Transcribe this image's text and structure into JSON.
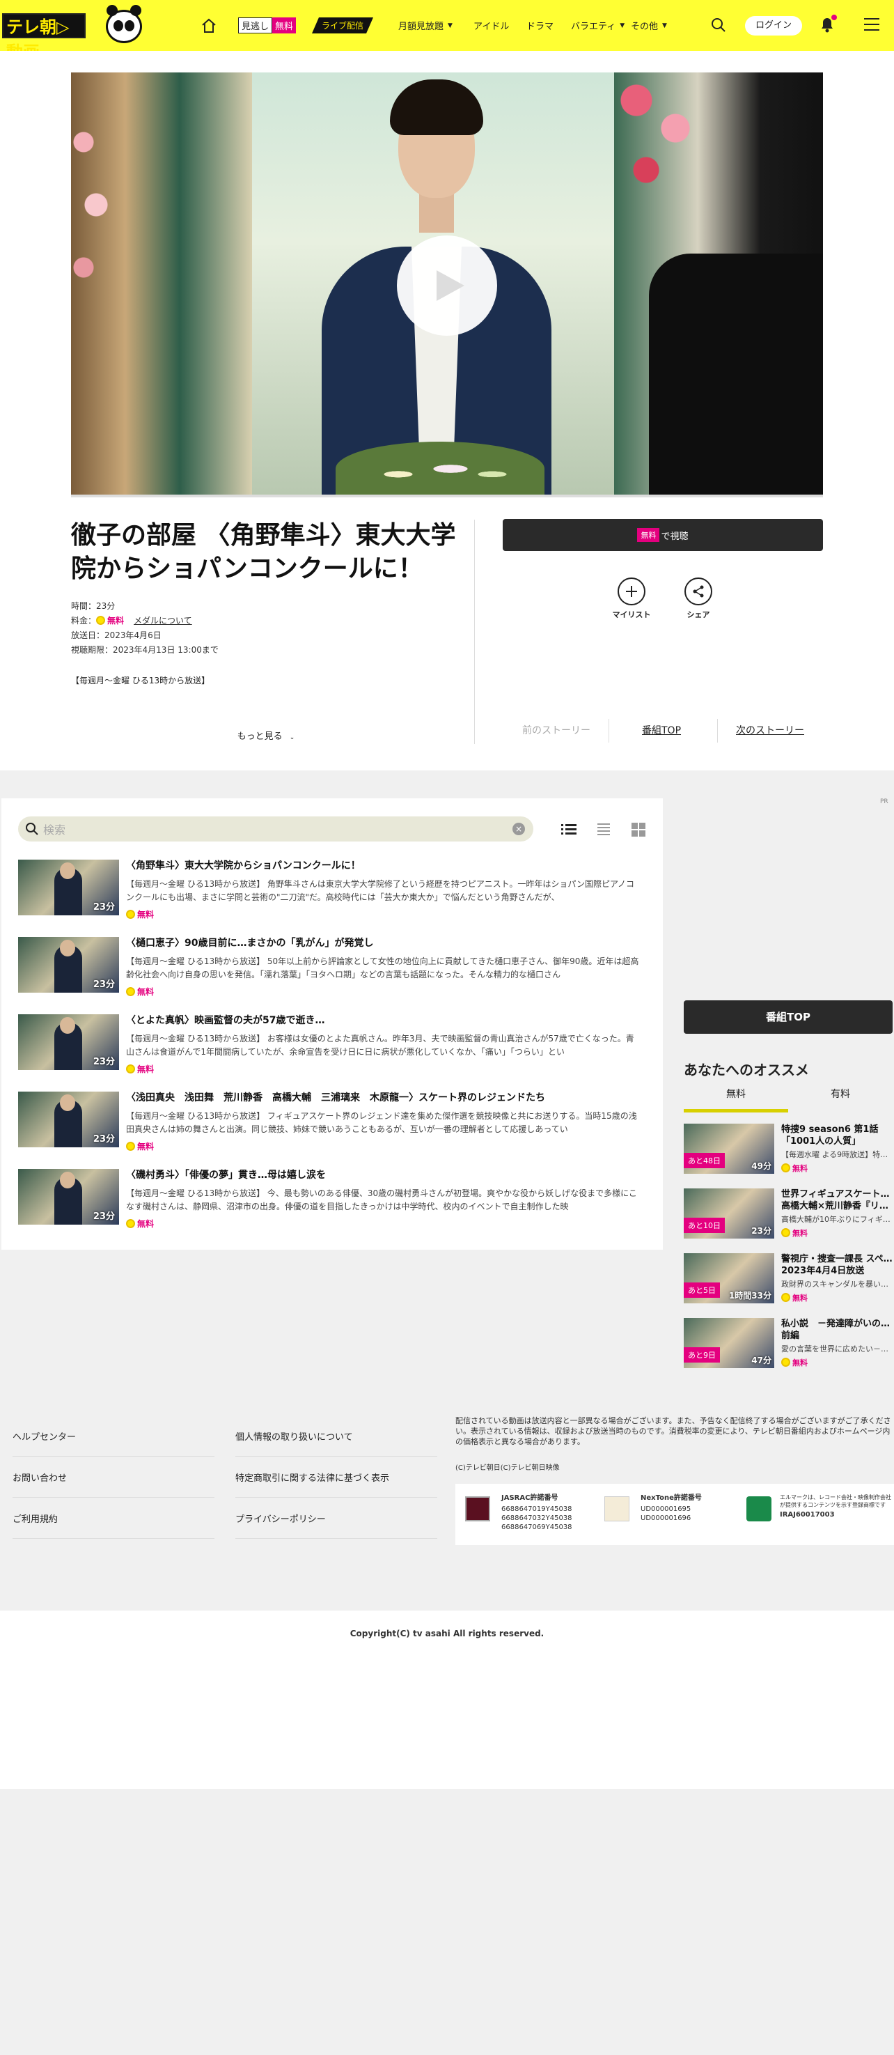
{
  "header": {
    "logo_text": "テレ朝▷動画",
    "free_tag_a": "見逃し",
    "free_tag_b": "無料",
    "live_tag": "ライブ配信",
    "nav": [
      "月額見放題",
      "アイドル",
      "ドラマ",
      "バラエティ",
      "その他"
    ],
    "login": "ログイン"
  },
  "program": {
    "title": "徹子の部屋 〈角野隼斗〉東大大学院からショパンコンクールに！",
    "duration_label": "時間：",
    "duration": "23分",
    "price_label": "料金：",
    "price": "無料",
    "medal_link": "メダルについて",
    "air_date": "放送日：2023年4月6日",
    "deadline": "視聴期限：2023年4月13日 13:00まで",
    "broadcast": "【毎週月～金曜 ひる13時から放送】",
    "more": "もっと見る",
    "watch_free": "無料",
    "watch_suffix": "で視聴",
    "mylist": "マイリスト",
    "share": "シェア",
    "prev_story": "前のストーリー",
    "program_top": "番組TOP",
    "next_story": "次のストーリー"
  },
  "list": {
    "search_placeholder": "検索",
    "episodes": [
      {
        "title": "〈角野隼斗〉東大大学院からショパンコンクールに！",
        "desc": "【毎週月～金曜 ひる13時から放送】 角野隼斗さんは東京大学大学院修了という経歴を持つピアニスト。一昨年はショパン国際ピアノコンクールにも出場、まさに学問と芸術の\"二刀流\"だ。高校時代には「芸大か東大か」で悩んだという角野さんだが、",
        "duration": "23分",
        "price": "無料"
      },
      {
        "title": "〈樋口恵子〉90歳目前に…まさかの「乳がん」が発覚し",
        "desc": "【毎週月～金曜 ひる13時から放送】 50年以上前から評論家として女性の地位向上に貢献してきた樋口恵子さん、御年90歳。近年は超高齢化社会へ向け自身の思いを発信。「濡れ落葉」「ヨタヘロ期」などの言葉も話題になった。そんな精力的な樋口さん",
        "duration": "23分",
        "price": "無料"
      },
      {
        "title": "〈とよた真帆〉映画監督の夫が57歳で逝き…",
        "desc": "【毎週月～金曜 ひる13時から放送】 お客様は女優のとよた真帆さん。昨年3月、夫で映画監督の青山真治さんが57歳で亡くなった。青山さんは食道がんで1年間闘病していたが、余命宣告を受け日に日に病状が悪化していくなか、「痛い」「つらい」とい",
        "duration": "23分",
        "price": "無料"
      },
      {
        "title": "〈浅田真央　浅田舞　荒川静香　高橋大輔　三浦璃来　木原龍一〉スケート界のレジェンドたち",
        "desc": "【毎週月～金曜 ひる13時から放送】 フィギュアスケート界のレジェンド達を集めた傑作選を競技映像と共にお送りする。当時15歳の浅田真央さんは姉の舞さんと出演。同じ競技、姉妹で競いあうこともあるが、互いが一番の理解者として応援しあってい",
        "duration": "23分",
        "price": "無料"
      },
      {
        "title": "〈磯村勇斗〉「俳優の夢」貫き…母は嬉し涙を",
        "desc": "【毎週月～金曜 ひる13時から放送】 今、最も勢いのある俳優、30歳の磯村勇斗さんが初登場。爽やかな役から妖しげな役まで多様にこなす磯村さんは、静岡県、沼津市の出身。俳優の道を目指したきっかけは中学時代、校内のイベントで自主制作した映",
        "duration": "23分",
        "price": "無料"
      }
    ]
  },
  "sidebar": {
    "pr": "PR",
    "top_button": "番組TOP",
    "rec_title": "あなたへのオススメ",
    "tab_free": "無料",
    "tab_paid": "有料",
    "items": [
      {
        "title": "特捜9 season6 第1話「1001人の人質」",
        "desc": "【毎週水曜 よる9時放送】特…",
        "left": "あと48日",
        "duration": "49分",
        "price": "無料"
      },
      {
        "title": "世界フィギュアスケート… 高橋大輔×荒川静香『リ…",
        "desc": "高橋大輔が10年ぶりにフィギ…",
        "left": "あと10日",
        "duration": "23分",
        "price": "無料"
      },
      {
        "title": "警視庁・捜査一課長 スペ… 2023年4月4日放送",
        "desc": "政財界のスキャンダルを暴い…",
        "left": "あと5日",
        "duration": "1時間33分",
        "price": "無料"
      },
      {
        "title": "私小説　－発達障がいの… 前編",
        "desc": "愛の言葉を世界に広めたい－…",
        "left": "あと9日",
        "duration": "47分",
        "price": "無料"
      }
    ]
  },
  "footer": {
    "links": [
      "ヘルプセンター",
      "お問い合わせ",
      "ご利用規約",
      "個人情報の取り扱いについて",
      "特定商取引に関する法律に基づく表示",
      "プライバシーポリシー"
    ],
    "note": "配信されている動画は放送内容と一部異なる場合がございます。また、予告なく配信終了する場合がございますがご了承ください。表示されている情報は、収録および放送当時のものです。消費税率の変更により、テレビ朝日番組内およびホームページ内の価格表示と異なる場合があります。",
    "copy2": "(C)テレビ朝日(C)テレビ朝日映像",
    "jasrac_title": "JASRAC許諾番号",
    "jasrac_1": "6688647019Y45038",
    "jasrac_2": "6688647032Y45038",
    "jasrac_3": "6688647069Y45038",
    "nextone_title": "NexTone許諾番号",
    "nextone_1": "UD000001695",
    "nextone_2": "UD000001696",
    "lmark_text": "エルマークは、レコード会社・映像制作会社が提供するコンテンツを示す登録商標です",
    "lmark_code": "IRAJ60017003",
    "copyright": "Copyright(C) tv asahi All rights reserved."
  }
}
